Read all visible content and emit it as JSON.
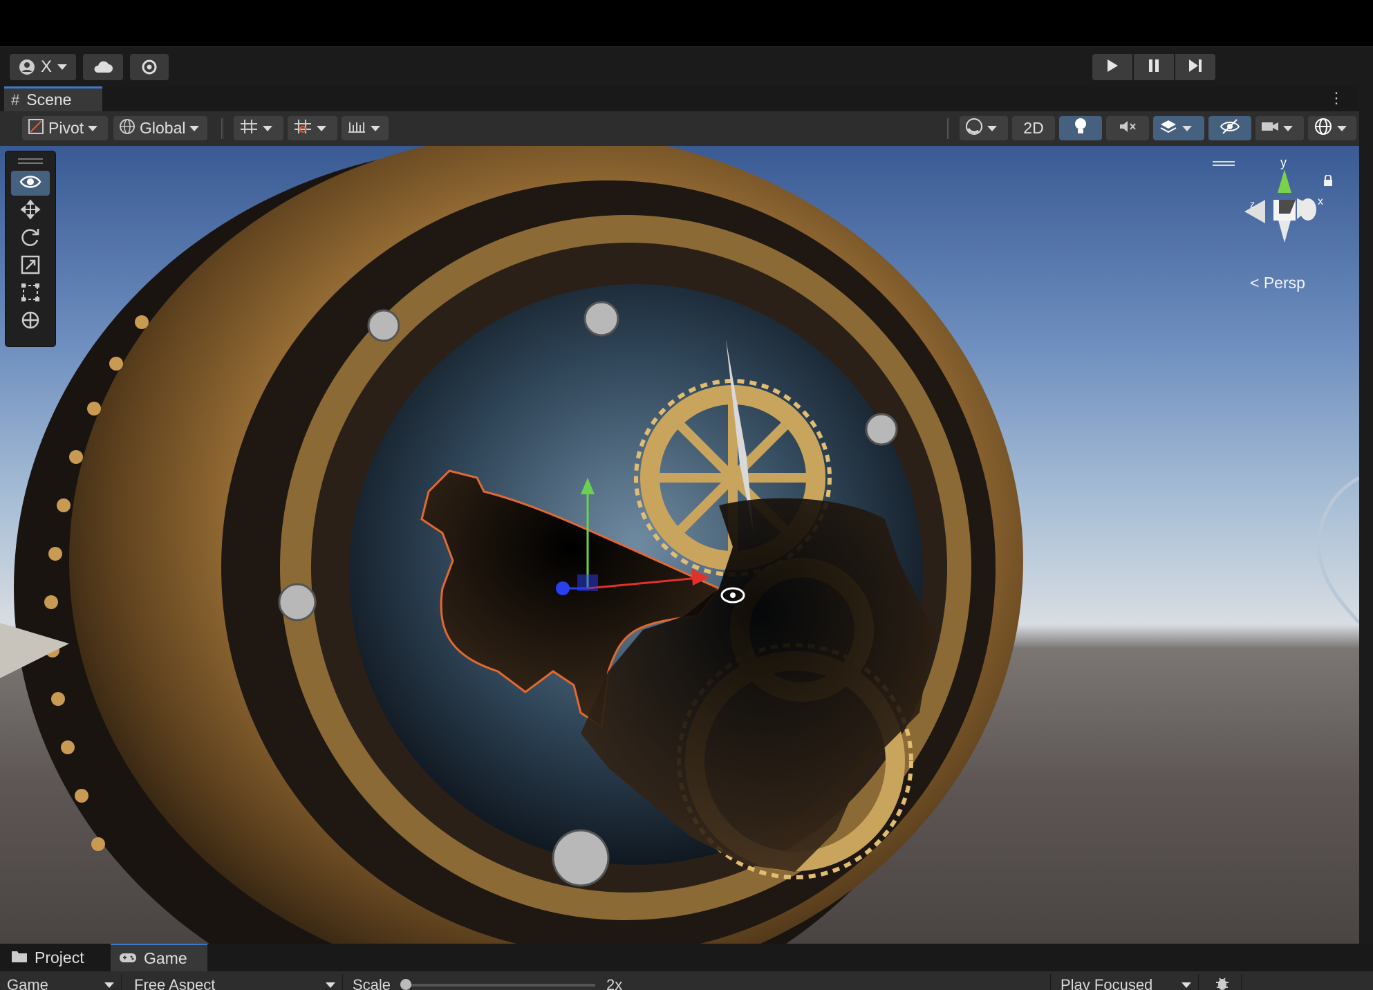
{
  "top_toolbar": {
    "account_label": "X",
    "play_controls": [
      "play",
      "pause",
      "step"
    ]
  },
  "scene_tab": {
    "label": "Scene"
  },
  "scene_toolbar": {
    "pivot_label": "Pivot",
    "global_label": "Global",
    "mode_2d_label": "2D"
  },
  "tools": [
    "view",
    "move",
    "rotate",
    "scale",
    "rect",
    "transform"
  ],
  "gizmo": {
    "y_label": "y",
    "x_label": "x",
    "z_label": "z",
    "projection_label": "Persp"
  },
  "bottom_tabs": [
    {
      "label": "Project",
      "active": false
    },
    {
      "label": "Game",
      "active": true
    }
  ],
  "game_toolbar": {
    "display_label": "Game",
    "aspect_label": "Free Aspect",
    "scale_label": "Scale",
    "scale_value": "2x",
    "play_mode_label": "Play Focused"
  },
  "colors": {
    "accent": "#3d78c9",
    "active_button": "#46607f",
    "panel": "#2d2d2d"
  }
}
